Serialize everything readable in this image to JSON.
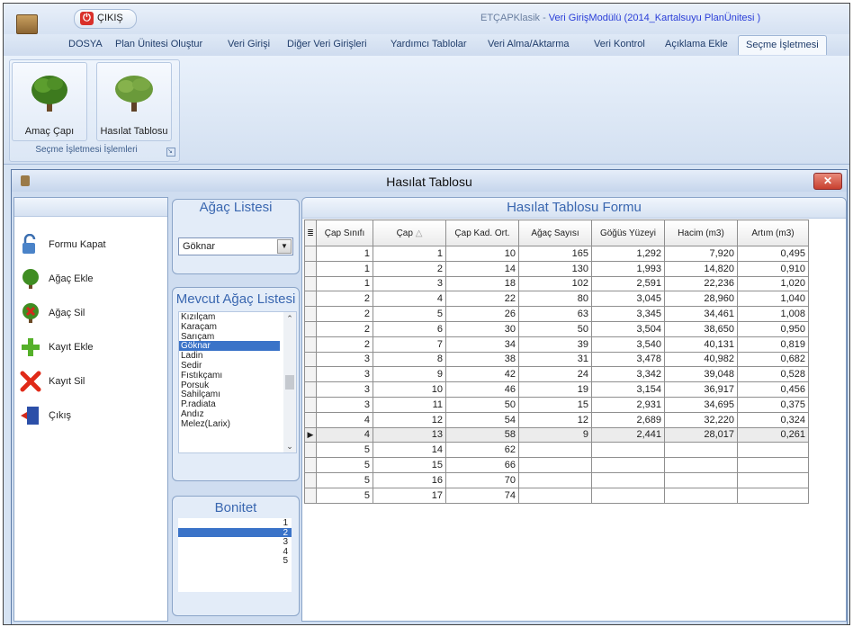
{
  "titlebar": {
    "exit_button": "ÇIKIŞ",
    "app_name": "ETÇAPKlasik - ",
    "module": "Veri GirişModülü (2014_Kartalsuyu PlanÜnitesi )"
  },
  "menu": {
    "tabs": [
      "DOSYA",
      "Plan Ünitesi Oluştur",
      "Veri Girişi",
      "Diğer Veri Girişleri",
      "Yardımcı Tablolar",
      "Veri Alma/Aktarma",
      "Veri Kontrol",
      "Açıklama Ekle",
      "Seçme İşletmesi"
    ],
    "active": "Seçme İşletmesi"
  },
  "ribbon": {
    "buttons": [
      "Amaç Çapı",
      "Hasılat Tablosu"
    ],
    "group_label": "Seçme İşletmesi İşlemleri"
  },
  "window": {
    "title": "Hasılat Tablosu"
  },
  "actions": [
    "Formu Kapat",
    "Ağaç Ekle",
    "Ağaç Sil",
    "Kayıt Ekle",
    "Kayıt Sil",
    "Çıkış"
  ],
  "agac_listesi": {
    "heading": "Ağaç Listesi",
    "selected": "Göknar"
  },
  "mevcut_agac_listesi": {
    "heading": "Mevcut Ağaç Listesi",
    "items": [
      "Kızılçam",
      "Karaçam",
      "Sarıçam",
      "Göknar",
      "Ladin",
      "Sedir",
      "Fıstıkçamı",
      "Porsuk",
      "Sahilçamı",
      "P.radiata",
      "Andız",
      "Melez(Larix)"
    ],
    "selected": "Göknar"
  },
  "bonitet": {
    "heading": "Bonitet",
    "items": [
      "1",
      "2",
      "3",
      "4",
      "5"
    ],
    "selected": "2"
  },
  "form": {
    "heading": "Hasılat Tablosu Formu",
    "columns": [
      "Çap Sınıfı",
      "Çap",
      "Çap Kad. Ort.",
      "Ağaç Sayısı",
      "Göğüs Yüzeyi",
      "Hacim (m3)",
      "Artım (m3)"
    ],
    "sort_indicator": "△",
    "current_row_marker": "▶",
    "rows": [
      [
        "1",
        "1",
        "10",
        "165",
        "1,292",
        "7,920",
        "0,495"
      ],
      [
        "1",
        "2",
        "14",
        "130",
        "1,993",
        "14,820",
        "0,910"
      ],
      [
        "1",
        "3",
        "18",
        "102",
        "2,591",
        "22,236",
        "1,020"
      ],
      [
        "2",
        "4",
        "22",
        "80",
        "3,045",
        "28,960",
        "1,040"
      ],
      [
        "2",
        "5",
        "26",
        "63",
        "3,345",
        "34,461",
        "1,008"
      ],
      [
        "2",
        "6",
        "30",
        "50",
        "3,504",
        "38,650",
        "0,950"
      ],
      [
        "2",
        "7",
        "34",
        "39",
        "3,540",
        "40,131",
        "0,819"
      ],
      [
        "3",
        "8",
        "38",
        "31",
        "3,478",
        "40,982",
        "0,682"
      ],
      [
        "3",
        "9",
        "42",
        "24",
        "3,342",
        "39,048",
        "0,528"
      ],
      [
        "3",
        "10",
        "46",
        "19",
        "3,154",
        "36,917",
        "0,456"
      ],
      [
        "3",
        "11",
        "50",
        "15",
        "2,931",
        "34,695",
        "0,375"
      ],
      [
        "4",
        "12",
        "54",
        "12",
        "2,689",
        "32,220",
        "0,324"
      ],
      [
        "4",
        "13",
        "58",
        "9",
        "2,441",
        "28,017",
        "0,261"
      ],
      [
        "5",
        "14",
        "62",
        "",
        "",
        "",
        ""
      ],
      [
        "5",
        "15",
        "66",
        "",
        "",
        "",
        ""
      ],
      [
        "5",
        "16",
        "70",
        "",
        "",
        "",
        ""
      ],
      [
        "5",
        "17",
        "74",
        "",
        "",
        "",
        ""
      ]
    ],
    "current_row": 12
  }
}
